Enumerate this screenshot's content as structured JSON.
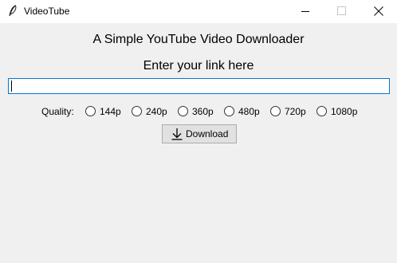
{
  "window": {
    "title": "VideoTube"
  },
  "main": {
    "heading": "A Simple YouTube Video Downloader",
    "prompt": "Enter your link here",
    "url_value": "",
    "quality_label": "Quality:",
    "quality_options": [
      "144p",
      "240p",
      "360p",
      "480p",
      "720p",
      "1080p"
    ],
    "download_label": "Download"
  },
  "colors": {
    "input_focus_border": "#0078d7",
    "background": "#f0f0f0"
  }
}
